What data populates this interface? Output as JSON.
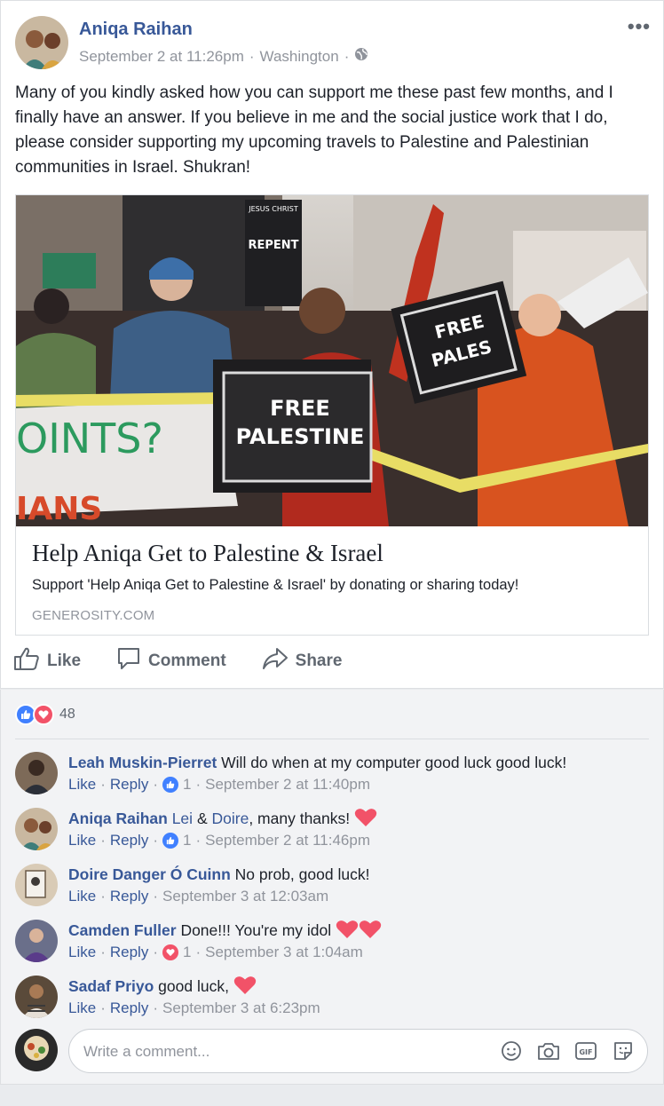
{
  "post": {
    "author": "Aniqa Raihan",
    "timestamp": "September 2 at 11:26pm",
    "location": "Washington",
    "more": "•••",
    "text": "Many of you kindly asked how you can support me these past few months, and I finally have an answer. If you believe in me and the social justice work that I do, please consider supporting my upcoming travels to Palestine and Palestinian communities in Israel. Shukran!",
    "link": {
      "title": "Help Aniqa Get to Palestine & Israel",
      "description": "Support 'Help Aniqa Get to Palestine & Israel' by donating or sharing today!",
      "domain": "GENEROSITY.COM",
      "image_sign_line1": "FREE",
      "image_sign_line2": "PALESTINE",
      "image_sign2_line1": "FREE",
      "image_sign2_line2": "PALES",
      "image_banner": "OINTS?",
      "image_banner2": "IANS",
      "image_sign3_line1": "JESUS CHRIST",
      "image_sign3_line2": "REPENT"
    },
    "actions": {
      "like": "Like",
      "comment": "Comment",
      "share": "Share"
    }
  },
  "reactions": {
    "count": "48"
  },
  "comments": [
    {
      "name": "Leah Muskin-Pierret",
      "text": "Will do when at my computer good luck good luck!",
      "like": "Like",
      "reply": "Reply",
      "reaction_count": "1",
      "time": "September 2 at 11:40pm"
    },
    {
      "name": "Aniqa Raihan",
      "mention1": "Lei",
      "amp": "&",
      "mention2": "Doire",
      "text": ", many thanks!",
      "like": "Like",
      "reply": "Reply",
      "reaction_count": "1",
      "time": "September 2 at 11:46pm"
    },
    {
      "name": "Doire Danger Ó Cuinn",
      "text": "No prob, good luck!",
      "like": "Like",
      "reply": "Reply",
      "time": "September 3 at 12:03am"
    },
    {
      "name": "Camden Fuller",
      "text": "Done!!! You're my idol",
      "like": "Like",
      "reply": "Reply",
      "reaction_count": "1",
      "time": "September 3 at 1:04am"
    },
    {
      "name": "Sadaf Priyo",
      "text": "good luck,",
      "like": "Like",
      "reply": "Reply",
      "time": "September 3 at 6:23pm"
    }
  ],
  "composer": {
    "placeholder": "Write a comment..."
  },
  "colors": {
    "brand_link": "#385898",
    "meta_gray": "#90949c",
    "like_blue": "#4080ff",
    "love_red": "#f25268"
  }
}
